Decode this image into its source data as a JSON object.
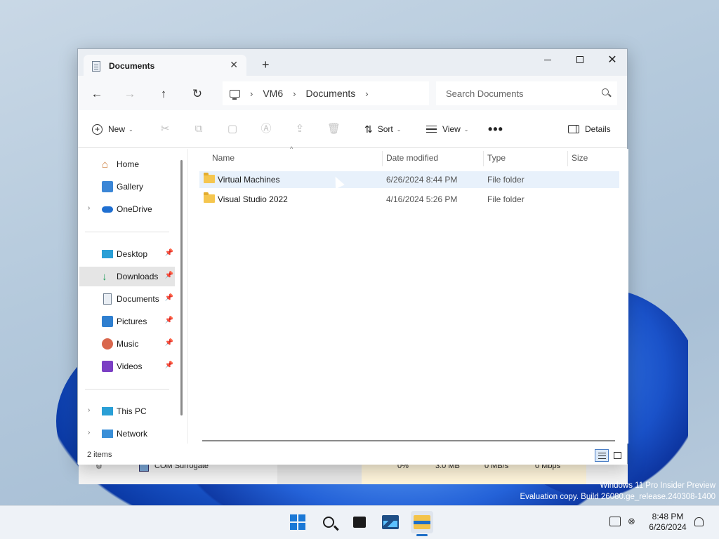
{
  "window": {
    "tab_label": "Documents",
    "tab_close": "✕",
    "new_tab": "+",
    "minimize": "",
    "maximize": "",
    "close": "✕"
  },
  "address": {
    "back": "←",
    "forward": "→",
    "up": "↑",
    "refresh": "↻",
    "crumbs": [
      "VM6",
      "Documents"
    ],
    "sep": "›",
    "search_placeholder": "Search Documents"
  },
  "toolbar": {
    "new_label": "New",
    "sort_label": "Sort",
    "view_label": "View",
    "more": "•••",
    "details_label": "Details",
    "chevron": "⌄"
  },
  "nav": {
    "items": [
      {
        "label": "Home"
      },
      {
        "label": "Gallery"
      },
      {
        "label": "OneDrive"
      },
      {
        "label": "Desktop"
      },
      {
        "label": "Downloads"
      },
      {
        "label": "Documents"
      },
      {
        "label": "Pictures"
      },
      {
        "label": "Music"
      },
      {
        "label": "Videos"
      },
      {
        "label": "This PC"
      },
      {
        "label": "Network"
      }
    ]
  },
  "columns": {
    "name": "Name",
    "date": "Date modified",
    "type": "Type",
    "size": "Size"
  },
  "files": [
    {
      "name": "Virtual Machines",
      "date": "6/26/2024 8:44 PM",
      "type": "File folder",
      "size": ""
    },
    {
      "name": "Visual Studio 2022",
      "date": "4/16/2024 5:26 PM",
      "type": "File folder",
      "size": ""
    }
  ],
  "status": {
    "count": "2 items"
  },
  "background_app": {
    "process": "COM Surrogate",
    "cpu": "0%",
    "memory": "3.0 MB",
    "disk": "0 MB/s",
    "network": "0 Mbps"
  },
  "watermark": {
    "line1": "Windows 11 Pro Insider Preview",
    "line2": "Evaluation copy. Build 26080.ge_release.240308-1400"
  },
  "taskbar": {
    "time": "8:48 PM",
    "date": "6/26/2024"
  },
  "colors": {
    "accent": "#1a78d6",
    "selection": "#e8f1fb",
    "folder": "#f5c64f"
  }
}
